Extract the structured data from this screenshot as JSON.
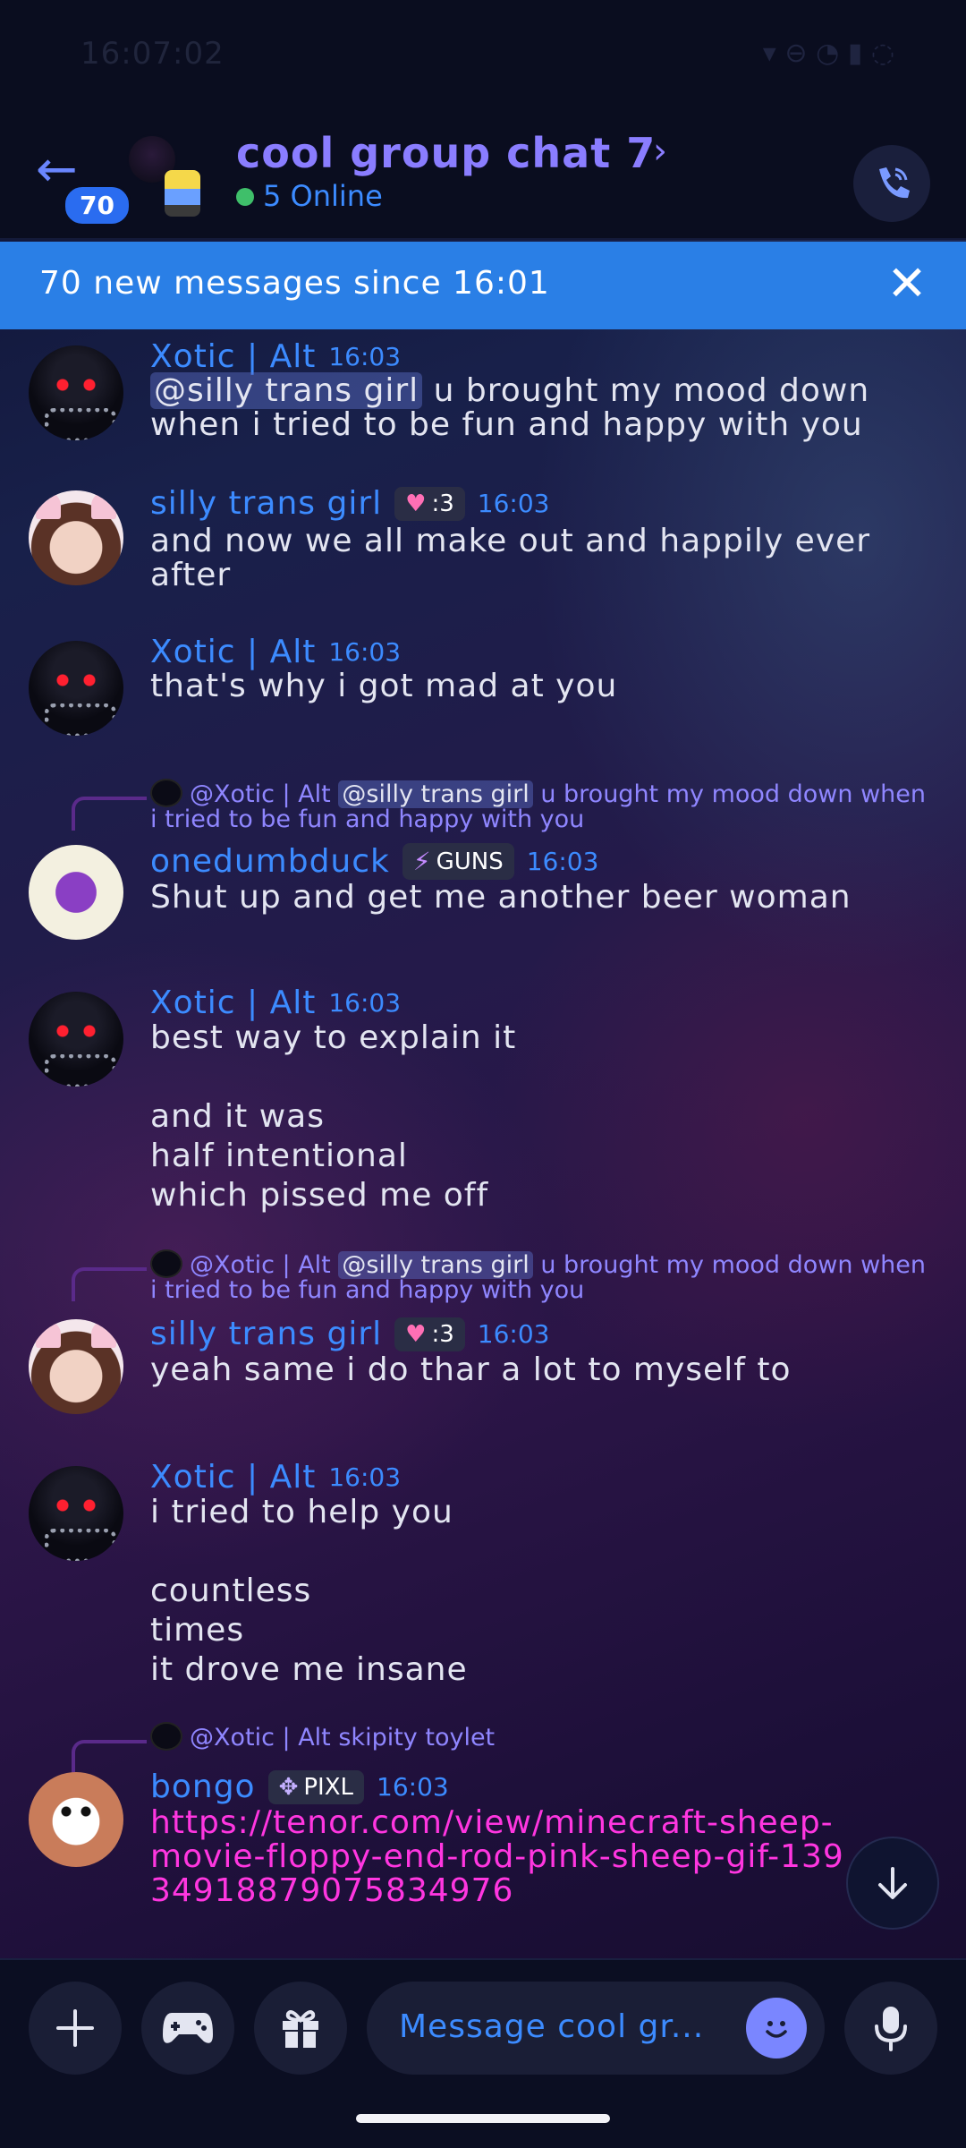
{
  "status": {
    "time": "16:07:02"
  },
  "header": {
    "unread_count": "70",
    "title": "cool group chat 7",
    "online": "5 Online"
  },
  "banner": {
    "text": "70 new messages since 16:01"
  },
  "messages": [
    {
      "name": "Xotic | Alt",
      "time": "16:03",
      "mention": "@silly trans girl",
      "text_after_mention": " u brought my mood down when i tried to be fun and happy with you"
    },
    {
      "name": "silly trans girl",
      "tag": ":3",
      "time": "16:03",
      "text": "and now we all make out and happily ever after"
    },
    {
      "name": "Xotic | Alt",
      "time": "16:03",
      "text": "that's why i got mad at you"
    },
    {
      "reply_author": "@Xotic | Alt",
      "reply_mention": "@silly trans girl",
      "reply_text": " u brought my mood down when i tried to be fun and happy with you",
      "name": "onedumbduck",
      "tag": "GUNS",
      "time": "16:03",
      "text": "Shut up and get me another beer woman"
    },
    {
      "name": "Xotic | Alt",
      "time": "16:03",
      "text": "best way to explain it\n\nand it was\nhalf intentional\nwhich pissed me off"
    },
    {
      "reply_author": "@Xotic | Alt",
      "reply_mention": "@silly trans girl",
      "reply_text": " u brought my mood down when i tried to be fun and happy with you",
      "name": "silly trans girl",
      "tag": ":3",
      "time": "16:03",
      "text": "yeah same i do thar a lot to myself to"
    },
    {
      "name": "Xotic | Alt",
      "time": "16:03",
      "text": "i tried to help you\n\ncountless\ntimes\nit drove me insane"
    },
    {
      "reply_author": "@Xotic | Alt",
      "reply_text": " skipity toylet",
      "name": "bongo",
      "tag": "PIXL",
      "time": "16:03",
      "link": "https://tenor.com/view/minecraft-sheep-movie-floppy-end-rod-pink-sheep-gif-13934918879075834976"
    }
  ],
  "composer": {
    "placeholder": "Message cool gr..."
  },
  "colors": {
    "accent": "#3c8bff",
    "title": "#8a7dff",
    "banner": "#2a7fe6",
    "link": "#ff36e0"
  }
}
